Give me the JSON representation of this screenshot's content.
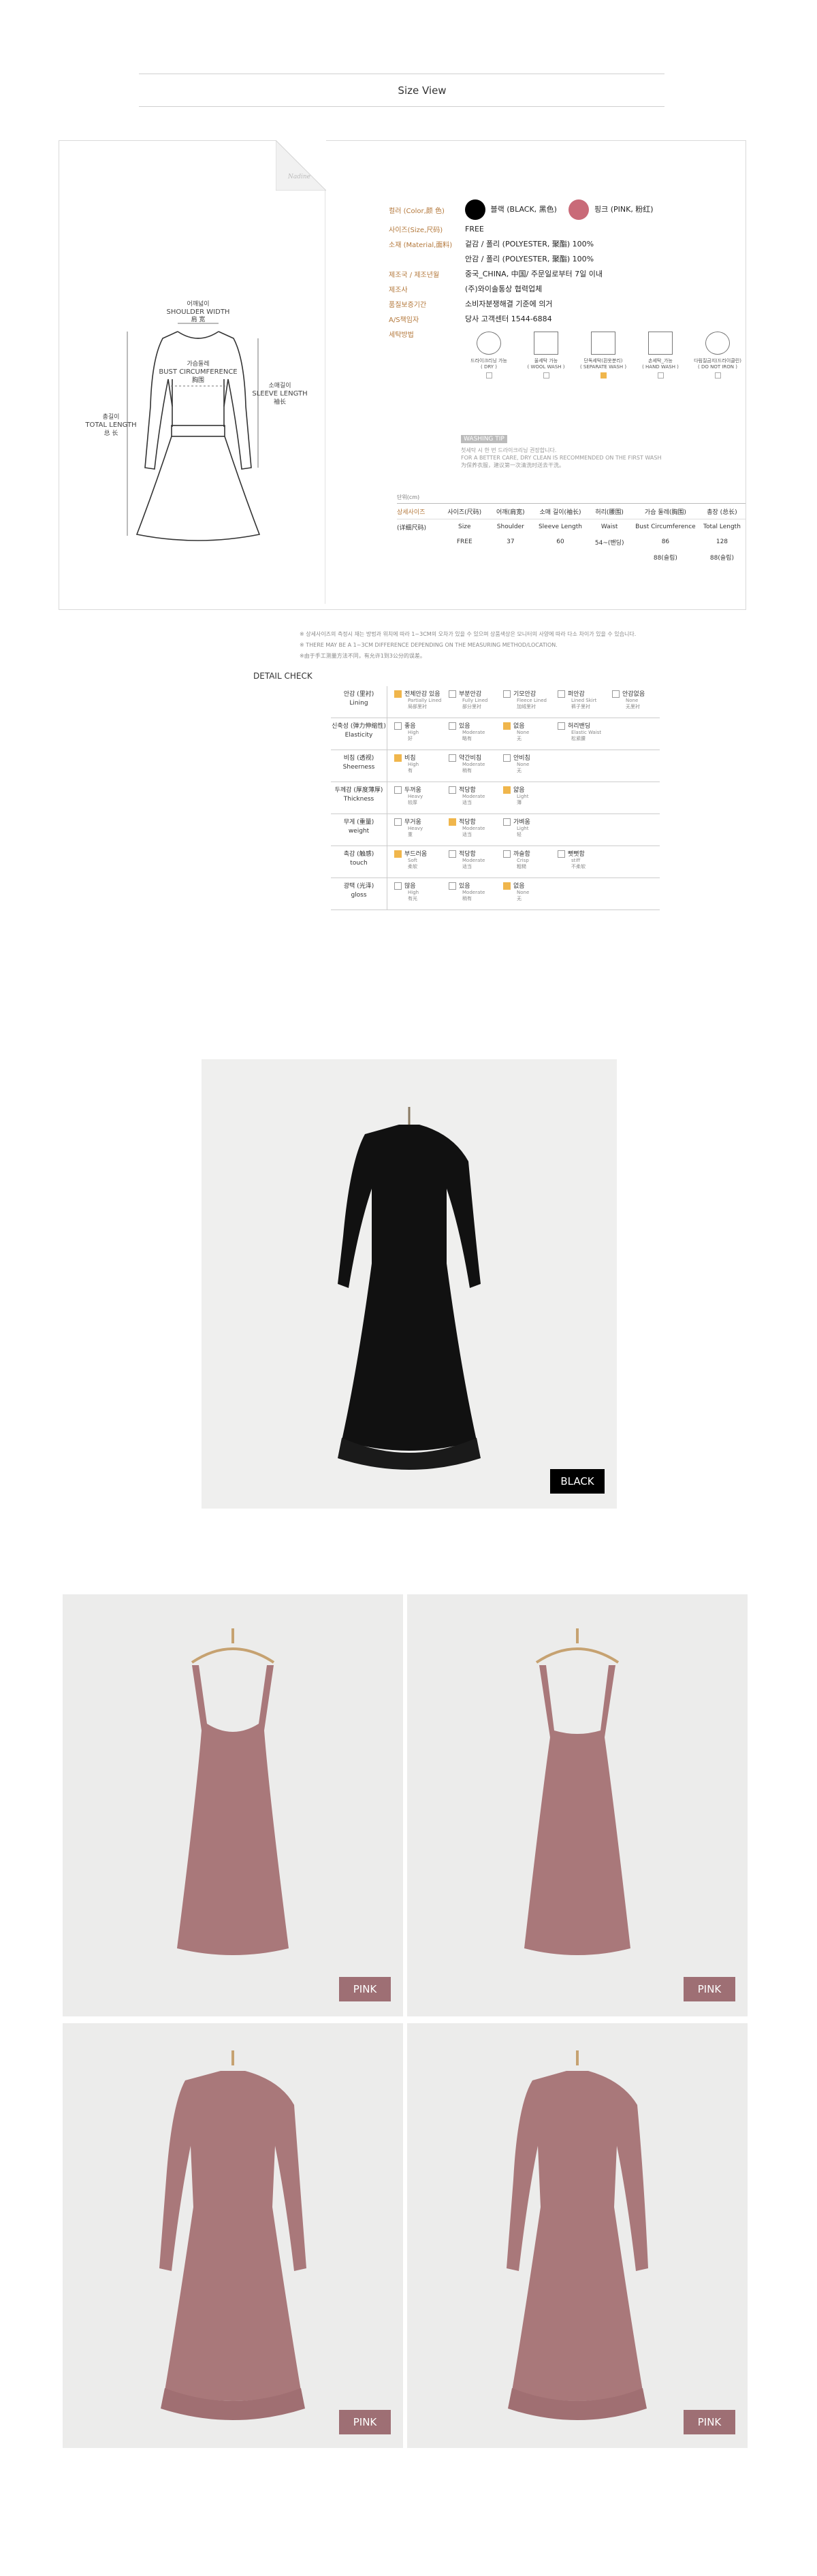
{
  "section_title": "Size View",
  "spec": {
    "diagram_labels": {
      "shoulder_ko": "어깨넓이",
      "shoulder_en": "SHOULDER WIDTH",
      "shoulder_cn": "肩 宽",
      "bust_ko": "가슴둘레",
      "bust_en": "BUST CIRCUMFERENCE",
      "bust_cn": "胸围",
      "sleeve_ko": "소매길이",
      "sleeve_en": "SLEEVE LENGTH",
      "sleeve_cn": "袖长",
      "total_ko": "총길이",
      "total_en": "TOTAL LENGTH",
      "total_cn": "总 长"
    },
    "brand_mark": "Nadine",
    "rows": [
      {
        "key": "컬러 (Color,颜 色)",
        "value": ""
      },
      {
        "key": "사이즈(Size,尺码)",
        "value": "FREE"
      },
      {
        "key": "소재 (Material,面料)",
        "value": "겉감 / 폴리 (POLYESTER, 聚酯) 100%"
      },
      {
        "key": "",
        "value": "안감 / 폴리 (POLYESTER, 聚酯) 100%"
      },
      {
        "key": "제조국 / 제조년월",
        "value": "중국_CHINA, 中国/ 주문일로부터 7일 이내"
      },
      {
        "key": "제조사",
        "value": "(주)와이솔통상 협력업체"
      },
      {
        "key": "품질보증기간",
        "value": "소비자분쟁해결 기준에 의거"
      },
      {
        "key": "A/S책임자",
        "value": "당사 고객센터 1544-6884"
      },
      {
        "key": "세탁방법",
        "value": ""
      }
    ],
    "colors": [
      {
        "label": "블랙 (BLACK, 黑色)",
        "hex": "#000000"
      },
      {
        "label": "핑크 (PINK, 粉红)",
        "hex": "#c96a78"
      }
    ],
    "wash": [
      {
        "label": "드라이크리닝 가능",
        "label2": "( DRY )",
        "checked": false
      },
      {
        "label": "울세탁 가능",
        "label2": "( WOOL WASH )",
        "checked": false
      },
      {
        "label": "단독세탁(흰옷분리)",
        "label2": "( SEPARATE WASH )",
        "checked": true
      },
      {
        "label": "손세탁_가능",
        "label2": "( HAND WASH )",
        "checked": false
      },
      {
        "label": "다림질금지(드라이클린)",
        "label2": "( DO NOT IRON )",
        "checked": false
      }
    ],
    "tip_label": "WASHING TIP",
    "tip_lines": [
      "첫세탁 시 한 번 드라이크리닝 권장합니다.",
      "FOR A BETTER CARE, DRY CLEAN IS RECOMMENDED ON THE FIRST WASH",
      "为保养衣服，建议第一次清洗时送去干洗。"
    ],
    "unit": "단위(cm)",
    "table": {
      "header_ko": [
        "상세사이즈",
        "사이즈(尺码)",
        "어깨(肩宽)",
        "소매 길이(袖长)",
        "허리(腰围)",
        "가슴 둘레(胸围)",
        "총장 (总长)"
      ],
      "header_en": [
        "(详细尺码)",
        "Size",
        "Shoulder",
        "Sleeve Length",
        "Waist",
        "Bust Circumference",
        "Total Length"
      ],
      "row": [
        "",
        "FREE",
        "37",
        "60",
        "54~(밴딩)",
        "86",
        "128"
      ],
      "row2": [
        "",
        "",
        "",
        "",
        "",
        "88(슬림)",
        "88(슬림)"
      ]
    }
  },
  "notes": [
    "※ 상세사이즈의 측정시 재는 방법과 위치에 따라 1~3CM의 오차가 있을 수 있으며 상품색상은 모니터의 사양에 따라 다소 차이가 있을 수 있습니다.",
    "※ THERE MAY BE A 1~3CM DIFFERENCE DEPENDING ON THE MEASURING METHOD/LOCATION.",
    "※由于手工测量方法不同，有允许1到3公分的误差。"
  ],
  "detail": {
    "title": "DETAIL CHECK",
    "rows": [
      {
        "k1": "안감 (里衬)",
        "k2": "Lining",
        "opts": [
          {
            "t": "전체안감 있음",
            "e": "Partially Lined",
            "c": "局部里衬",
            "on": true
          },
          {
            "t": "부분안감",
            "e": "Fully Lined",
            "c": "部分里衬",
            "on": false
          },
          {
            "t": "기모안감",
            "e": "Fleece Lined",
            "c": "加绒里衬",
            "on": false
          },
          {
            "t": "퍼안감",
            "e": "Lined Skirt",
            "c": "裤子里衬",
            "on": false
          },
          {
            "t": "안감없음",
            "e": "None",
            "c": "无里衬",
            "on": false
          }
        ]
      },
      {
        "k1": "신축성 (弹力伸缩性)",
        "k2": "Elasticity",
        "opts": [
          {
            "t": "좋음",
            "e": "High",
            "c": "好",
            "on": false
          },
          {
            "t": "있음",
            "e": "Moderate",
            "c": "略有",
            "on": false
          },
          {
            "t": "없음",
            "e": "None",
            "c": "无",
            "on": true
          },
          {
            "t": "허리밴딩",
            "e": "Elastic Waist",
            "c": "松紧腰",
            "on": false
          }
        ]
      },
      {
        "k1": "비침 (透视)",
        "k2": "Sheerness",
        "opts": [
          {
            "t": "비침",
            "e": "High",
            "c": "有",
            "on": true
          },
          {
            "t": "약간비침",
            "e": "Moderate",
            "c": "稍有",
            "on": false
          },
          {
            "t": "안비침",
            "e": "None",
            "c": "无",
            "on": false
          }
        ]
      },
      {
        "k1": "두께감 (厚度薄厚)",
        "k2": "Thickness",
        "opts": [
          {
            "t": "두꺼움",
            "e": "Heavy",
            "c": "较厚",
            "on": false
          },
          {
            "t": "적당함",
            "e": "Moderate",
            "c": "适当",
            "on": false
          },
          {
            "t": "얇음",
            "e": "Light",
            "c": "薄",
            "on": true
          }
        ]
      },
      {
        "k1": "무게 (重量)",
        "k2": "weight",
        "opts": [
          {
            "t": "무거움",
            "e": "Heavy",
            "c": "重",
            "on": false
          },
          {
            "t": "적당함",
            "e": "Moderate",
            "c": "适当",
            "on": true
          },
          {
            "t": "가벼움",
            "e": "Light",
            "c": "轻",
            "on": false
          }
        ]
      },
      {
        "k1": "촉감 (触感)",
        "k2": "touch",
        "opts": [
          {
            "t": "부드러움",
            "e": "Soft",
            "c": "柔软",
            "on": true
          },
          {
            "t": "적당함",
            "e": "Moderate",
            "c": "适当",
            "on": false
          },
          {
            "t": "까슬함",
            "e": "Crisp",
            "c": "粗糙",
            "on": false
          },
          {
            "t": "뻣뻣함",
            "e": "stiff",
            "c": "不柔软",
            "on": false
          }
        ]
      },
      {
        "k1": "광택 (光泽)",
        "k2": "gloss",
        "opts": [
          {
            "t": "많음",
            "e": "High",
            "c": "有光",
            "on": false
          },
          {
            "t": "있음",
            "e": "Moderate",
            "c": "稍有",
            "on": false
          },
          {
            "t": "없음",
            "e": "None",
            "c": "无",
            "on": true
          }
        ]
      }
    ]
  },
  "photos": {
    "black_tag": "BLACK",
    "pink_tag": "PINK",
    "black_color": "#111111",
    "pink_color": "#a9787a",
    "pink_tag_color": "#9e6f74"
  }
}
